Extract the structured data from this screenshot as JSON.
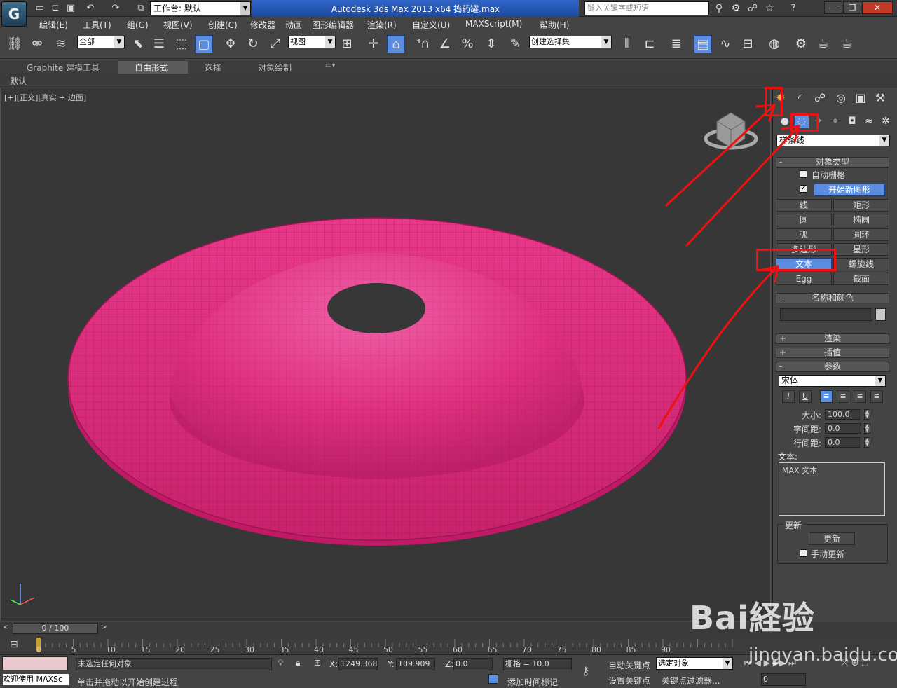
{
  "app": {
    "window_title": "Autodesk 3ds Max  2013 x64      捣药罐.max",
    "workspace_label": "工作台: 默认",
    "search_placeholder": "键入关键字或短语",
    "window_buttons": [
      "—",
      "❐",
      "✕"
    ]
  },
  "menu": [
    "编辑(E)",
    "工具(T)",
    "组(G)",
    "视图(V)",
    "创建(C)",
    "修改器",
    "动画",
    "图形编辑器",
    "渲染(R)",
    "自定义(U)",
    "MAXScript(M)",
    "帮助(H)"
  ],
  "toolbar": {
    "selection_filter": "全部",
    "reference_coord": "视图",
    "named_selection": "创建选择集"
  },
  "ribbon": {
    "tabs": [
      "Graphite 建模工具",
      "自由形式",
      "选择",
      "对象绘制"
    ],
    "active_tab": "自由形式",
    "sub_label": "默认"
  },
  "viewport": {
    "label": "[+][正交][真实 + 边面]",
    "object_color": "#e0307e"
  },
  "command_panel": {
    "category": "样条线",
    "object_type_title": "对象类型",
    "auto_grid": "自动栅格",
    "start_new_shape": "开始新图形",
    "shapes": [
      "线",
      "矩形",
      "圆",
      "椭圆",
      "弧",
      "圆环",
      "多边形",
      "星形",
      "文本",
      "螺旋线",
      "Egg",
      "截面"
    ],
    "active_shape": "文本",
    "name_color_title": "名称和颜色",
    "render_title": "渲染",
    "interp_title": "插值",
    "params_title": "参数",
    "font": "宋体",
    "size_label": "大小:",
    "size_value": "100.0",
    "kerning_label": "字间距:",
    "kerning_value": "0.0",
    "leading_label": "行间距:",
    "leading_value": "0.0",
    "text_label": "文本:",
    "text_value": "MAX 文本",
    "update_title": "更新",
    "update_button": "更新",
    "manual_update": "手动更新"
  },
  "timeline": {
    "position": "0 / 100",
    "ticks": [
      "0",
      "5",
      "10",
      "15",
      "20",
      "25",
      "30",
      "35",
      "40",
      "45",
      "50",
      "55",
      "60",
      "65",
      "70",
      "75",
      "80",
      "85",
      "90"
    ]
  },
  "status": {
    "welcome": "欢迎使用 MAXSc",
    "selection": "未选定任何对象",
    "prompt": "单击并拖动以开始创建过程",
    "x_label": "X:",
    "x_value": "1249.368",
    "y_label": "Y:",
    "y_value": "109.909",
    "z_label": "Z:",
    "z_value": "0.0",
    "grid": "栅格 = 10.0",
    "add_time_tag": "添加时间标记",
    "auto_key": "自动关键点",
    "set_key": "设置关键点",
    "key_mode": "选定对象",
    "key_filters": "关键点过滤器...",
    "frame": "0"
  },
  "watermark": {
    "brand": "Bai経验",
    "url": "jingyan.baidu.com"
  }
}
